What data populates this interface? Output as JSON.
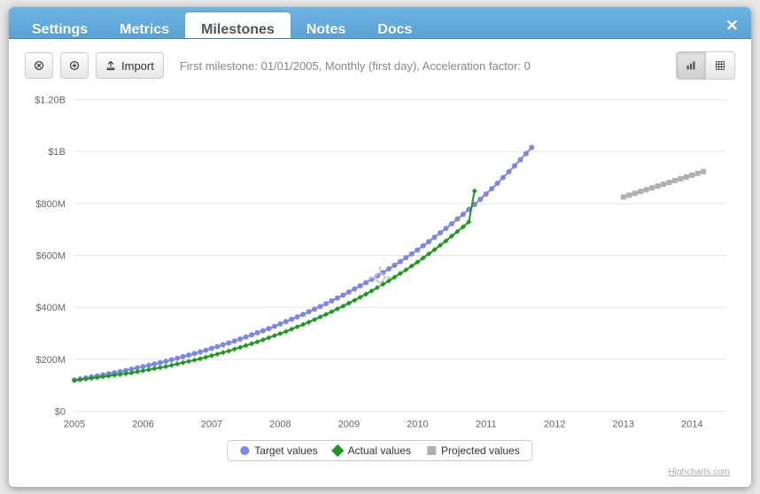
{
  "tabs": {
    "settings": "Settings",
    "metrics": "Metrics",
    "milestones": "Milestones",
    "notes": "Notes",
    "docs": "Docs"
  },
  "toolbar": {
    "import_label": "Import",
    "status_text": "First milestone: 01/01/2005, Monthly (first day), Acceleration factor: 0"
  },
  "legend": {
    "target": "Target values",
    "actual": "Actual values",
    "projected": "Projected values"
  },
  "credit": "Highcharts.com",
  "yticks": [
    "$0",
    "$200M",
    "$400M",
    "$600M",
    "$800M",
    "$1B",
    "$1.20B"
  ],
  "xticks": [
    "2005",
    "2006",
    "2007",
    "2008",
    "2009",
    "2010",
    "2011",
    "2012",
    "2013",
    "2014"
  ],
  "colors": {
    "target": "#7c86e8",
    "actual": "#1a9a1a",
    "projected": "#b0b0b0"
  },
  "chart_data": {
    "type": "line",
    "title": "",
    "xlabel": "",
    "ylabel": "",
    "ylim": [
      0,
      1200000000
    ],
    "y_tick_values": [
      0,
      200000000,
      400000000,
      600000000,
      800000000,
      1000000000,
      1200000000
    ],
    "series": [
      {
        "name": "Target values",
        "color": "#7c86e8",
        "marker": "circle",
        "x_start": 2005.0,
        "x_step_years": 0.0833,
        "values": [
          120000000,
          124000000,
          128000000,
          132000000,
          136000000,
          140000000,
          144000000,
          148000000,
          152000000,
          157000000,
          162000000,
          167000000,
          172000000,
          177000000,
          182000000,
          187000000,
          192000000,
          198000000,
          204000000,
          210000000,
          216000000,
          222000000,
          228000000,
          235000000,
          242000000,
          249000000,
          256000000,
          263000000,
          270000000,
          278000000,
          286000000,
          294000000,
          302000000,
          310000000,
          318000000,
          327000000,
          336000000,
          345000000,
          354000000,
          363000000,
          373000000,
          383000000,
          393000000,
          403000000,
          414000000,
          425000000,
          436000000,
          447000000,
          459000000,
          471000000,
          483000000,
          495000000,
          508000000,
          521000000,
          534000000,
          548000000,
          562000000,
          576000000,
          591000000,
          606000000,
          621000000,
          637000000,
          653000000,
          670000000,
          687000000,
          704000000,
          722000000,
          740000000,
          758000000,
          777000000,
          796000000,
          816000000,
          836000000,
          857000000,
          878000000,
          900000000,
          922000000,
          945000000,
          968000000,
          992000000,
          1016000000
        ]
      },
      {
        "name": "Actual values",
        "color": "#1a9a1a",
        "marker": "diamond",
        "x_start": 2005.0,
        "x_step_years": 0.0833,
        "values": [
          118000000,
          121000000,
          124000000,
          127000000,
          130000000,
          133000000,
          136000000,
          139000000,
          142000000,
          145000000,
          148000000,
          152000000,
          156000000,
          160000000,
          164000000,
          168000000,
          172000000,
          177000000,
          182000000,
          187000000,
          192000000,
          197000000,
          202000000,
          208000000,
          214000000,
          220000000,
          226000000,
          232000000,
          239000000,
          246000000,
          253000000,
          260000000,
          267000000,
          275000000,
          283000000,
          291000000,
          299000000,
          307000000,
          316000000,
          325000000,
          334000000,
          343000000,
          353000000,
          363000000,
          373000000,
          383000000,
          394000000,
          405000000,
          416000000,
          427000000,
          439000000,
          451000000,
          463000000,
          476000000,
          489000000,
          502000000,
          516000000,
          530000000,
          544000000,
          559000000,
          574000000,
          590000000,
          606000000,
          622000000,
          639000000,
          656000000,
          674000000,
          692000000,
          710000000,
          729000000,
          848000000
        ]
      },
      {
        "name": "Projected values",
        "color": "#b0b0b0",
        "marker": "square",
        "x_start": 2013.0,
        "x_step_years": 0.0833,
        "values": [
          825000000,
          832000000,
          839000000,
          846000000,
          853000000,
          860000000,
          867000000,
          874000000,
          881000000,
          888000000,
          895000000,
          902000000,
          909000000,
          916000000,
          923000000
        ]
      }
    ]
  }
}
